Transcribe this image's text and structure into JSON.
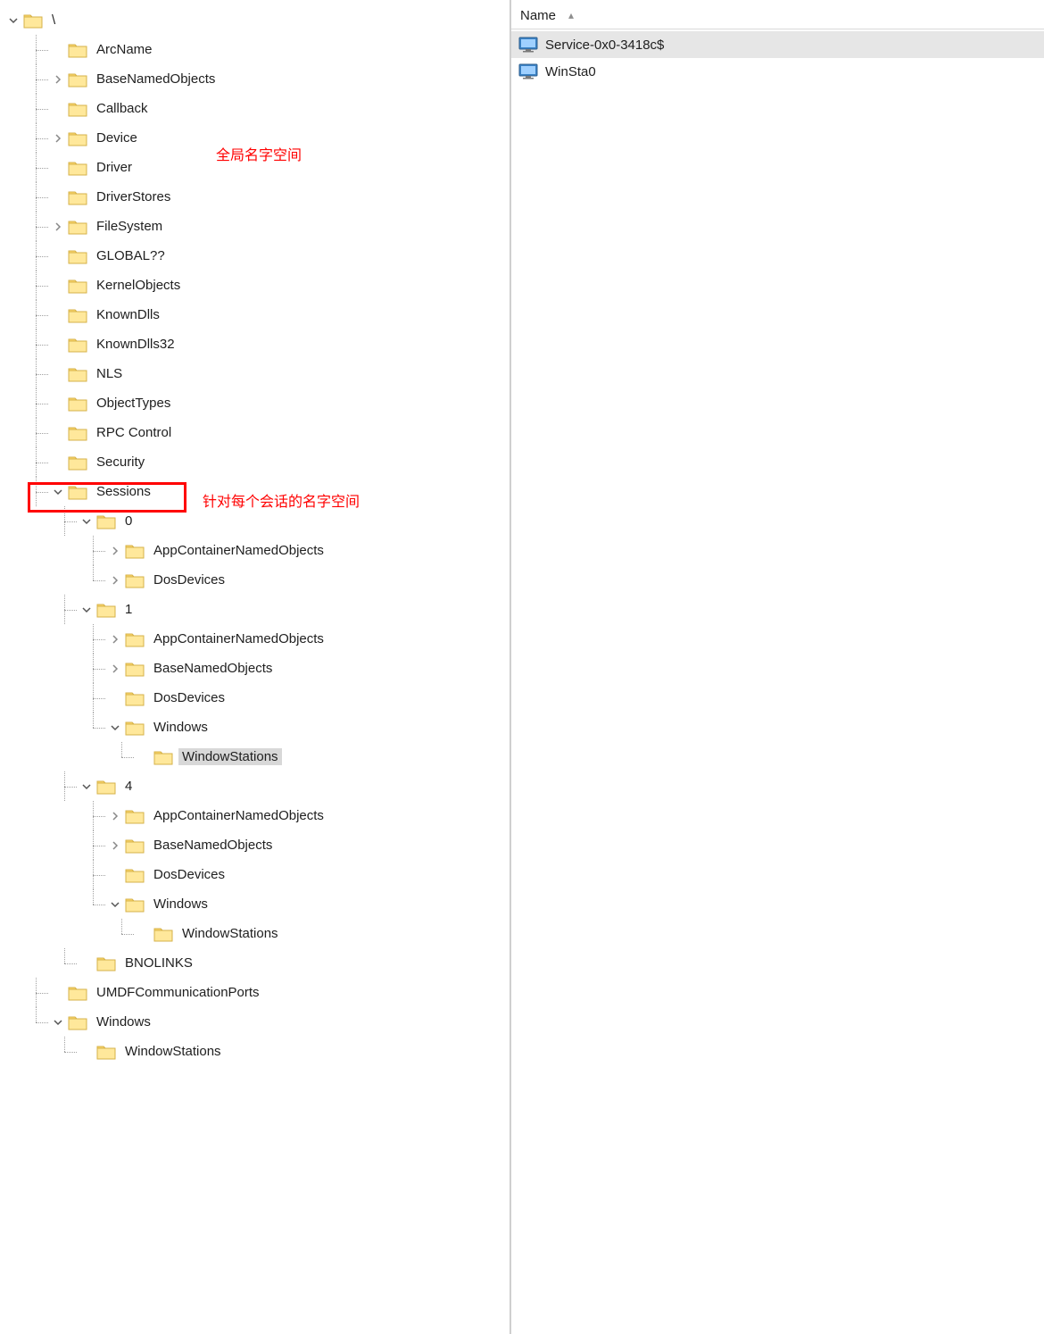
{
  "right": {
    "header": "Name",
    "items": [
      {
        "key": "svc",
        "label": "Service-0x0-3418c$",
        "selected": true
      },
      {
        "key": "ws0",
        "label": "WinSta0",
        "selected": false
      }
    ]
  },
  "annotations": {
    "global_ns": "全局名字空间",
    "session_ns": "针对每个会话的名字空间"
  },
  "tree": {
    "root": {
      "label": "\\",
      "expanded": true,
      "children": [
        {
          "label": "ArcName"
        },
        {
          "label": "BaseNamedObjects",
          "collapsed": true
        },
        {
          "label": "Callback"
        },
        {
          "label": "Device",
          "collapsed": true
        },
        {
          "label": "Driver"
        },
        {
          "label": "DriverStores"
        },
        {
          "label": "FileSystem",
          "collapsed": true
        },
        {
          "label": "GLOBAL??"
        },
        {
          "label": "KernelObjects"
        },
        {
          "label": "KnownDlls"
        },
        {
          "label": "KnownDlls32"
        },
        {
          "label": "NLS"
        },
        {
          "label": "ObjectTypes"
        },
        {
          "label": "RPC Control"
        },
        {
          "label": "Security"
        },
        {
          "label": "Sessions",
          "expanded": true,
          "children": [
            {
              "label": "0",
              "expanded": true,
              "children": [
                {
                  "label": "AppContainerNamedObjects",
                  "collapsed": true
                },
                {
                  "label": "DosDevices",
                  "collapsed": true
                }
              ]
            },
            {
              "label": "1",
              "expanded": true,
              "children": [
                {
                  "label": "AppContainerNamedObjects",
                  "collapsed": true
                },
                {
                  "label": "BaseNamedObjects",
                  "collapsed": true
                },
                {
                  "label": "DosDevices"
                },
                {
                  "label": "Windows",
                  "expanded": true,
                  "children": [
                    {
                      "label": "WindowStations",
                      "selected": true
                    }
                  ]
                }
              ]
            },
            {
              "label": "4",
              "expanded": true,
              "children": [
                {
                  "label": "AppContainerNamedObjects",
                  "collapsed": true
                },
                {
                  "label": "BaseNamedObjects",
                  "collapsed": true
                },
                {
                  "label": "DosDevices"
                },
                {
                  "label": "Windows",
                  "expanded": true,
                  "children": [
                    {
                      "label": "WindowStations"
                    }
                  ]
                }
              ]
            },
            {
              "label": "BNOLINKS"
            }
          ]
        },
        {
          "label": "UMDFCommunicationPorts"
        },
        {
          "label": "Windows",
          "expanded": true,
          "children": [
            {
              "label": "WindowStations"
            }
          ]
        }
      ]
    }
  }
}
